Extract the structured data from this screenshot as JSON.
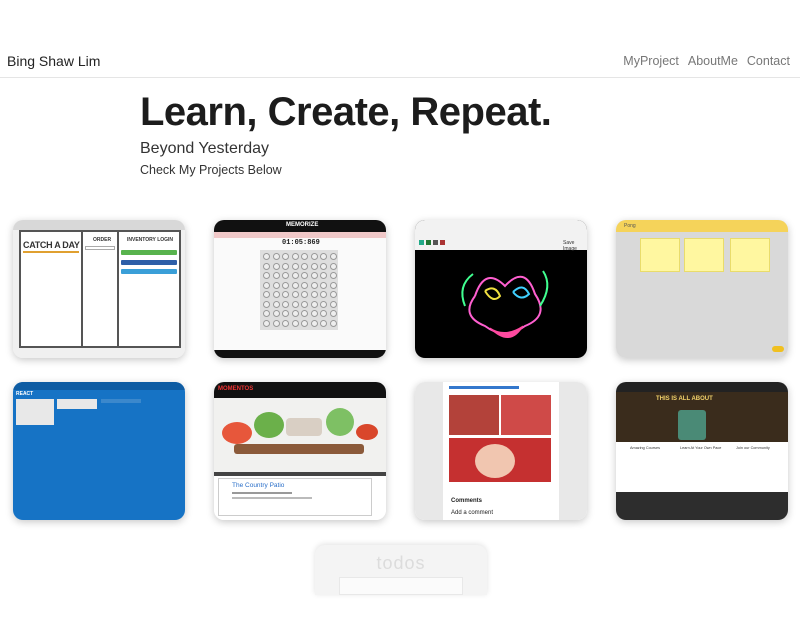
{
  "navbar": {
    "brand": "Bing Shaw Lim",
    "links": [
      "MyProject",
      "AboutMe",
      "Contact"
    ]
  },
  "hero": {
    "title": "Learn, Create, Repeat.",
    "subtitle": "Beyond Yesterday",
    "caption": "Check My Projects Below"
  },
  "projects": [
    {
      "logo": "CATCH A DAY",
      "heading_1": "ORDER",
      "heading_2": "INVENTORY LOGIN"
    },
    {
      "title": "MEMORIZE",
      "timer": "01:05:869"
    },
    {
      "action": "Save Image"
    },
    {
      "title": "Pong"
    },
    {
      "title": "REACT"
    },
    {
      "brand": "MOMENTOS",
      "restaurant": "The Country Patio"
    },
    {
      "label": "Comments",
      "action": "Add a comment"
    },
    {
      "headline": "THIS IS ALL ABOUT",
      "columns": [
        "Amazing Courses",
        "Learn At Your Own Pace",
        "Join our Community"
      ]
    },
    {
      "title": "todos"
    }
  ],
  "colors": {
    "accent_blue": "#1673c5",
    "brand_red": "#c53030",
    "sticky_yellow": "#fff7a0"
  }
}
